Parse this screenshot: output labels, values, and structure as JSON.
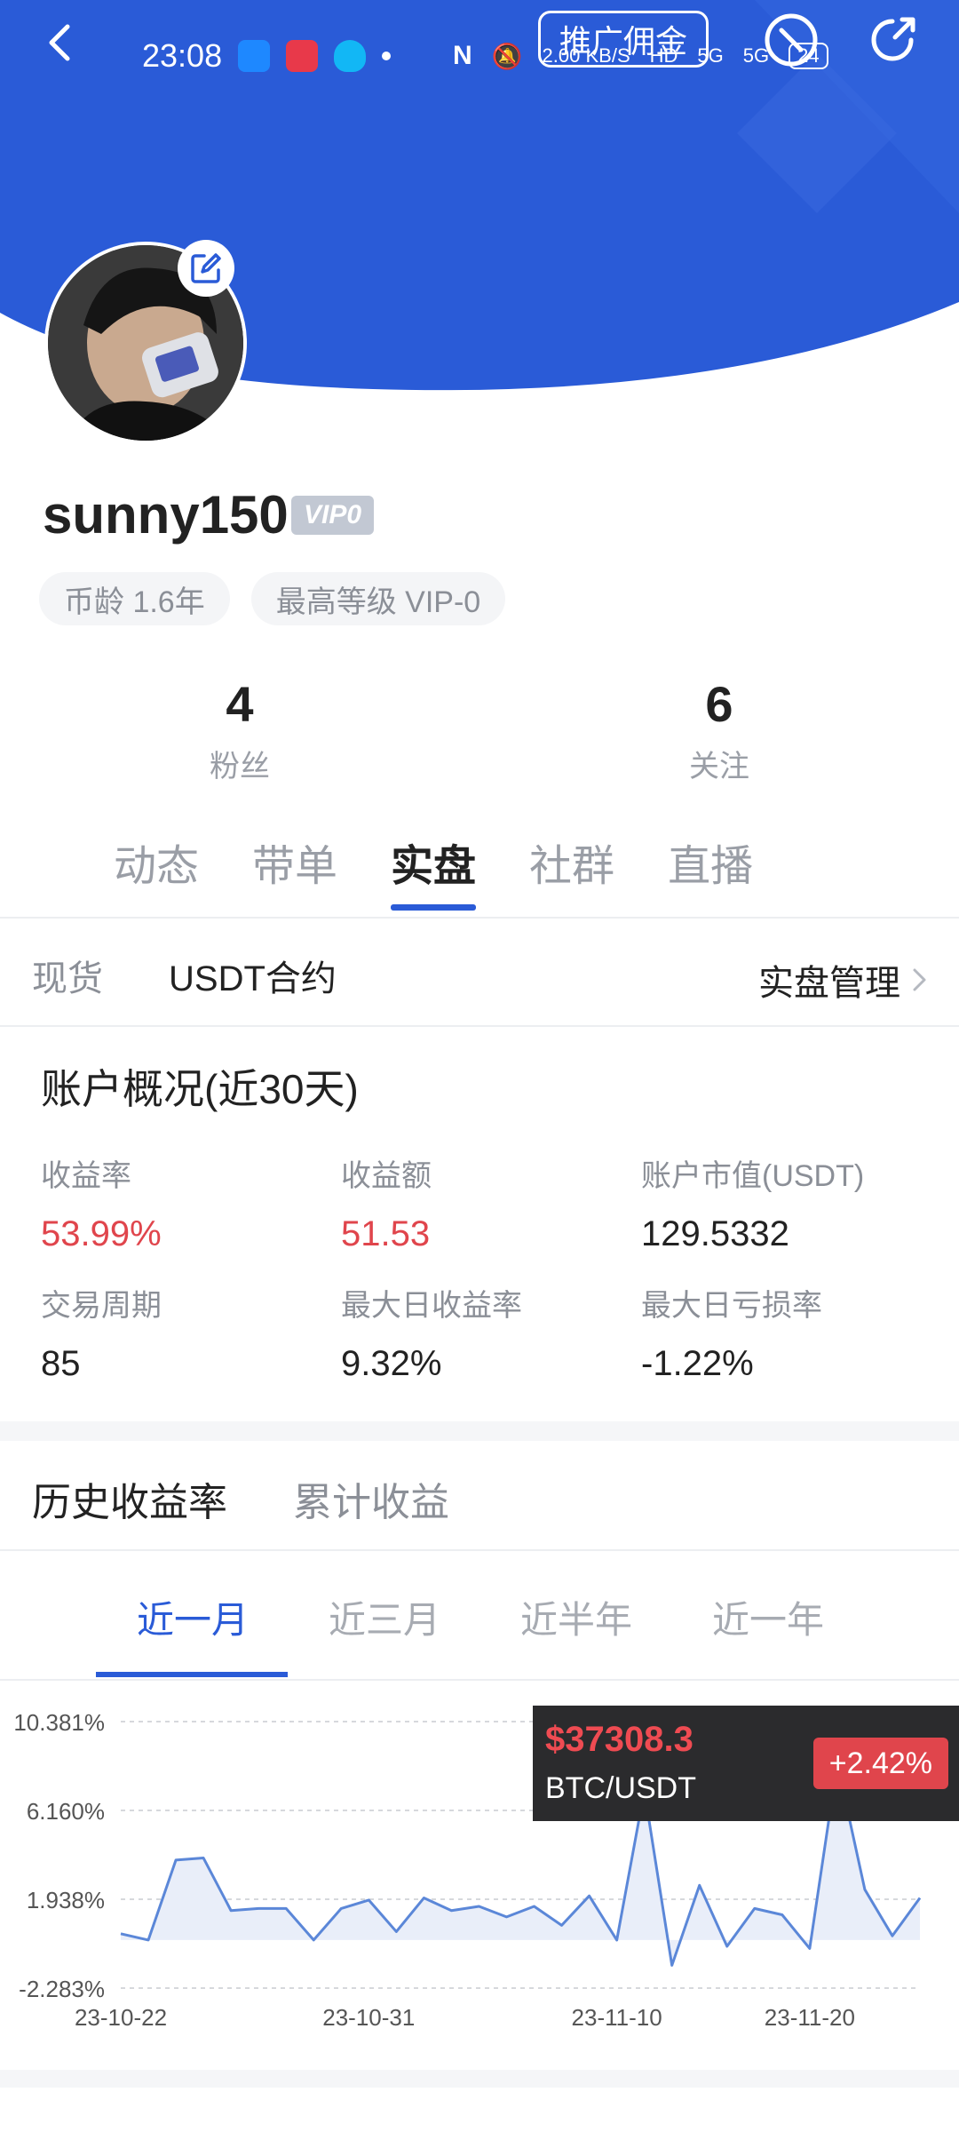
{
  "status_bar": {
    "time": "23:08",
    "network_speed": "2.00",
    "speed_unit": "KB/S",
    "hd": "HD",
    "net1": "5G",
    "net2": "5G",
    "battery": "24"
  },
  "header": {
    "promo_label": "推广佣金",
    "brand_color": "#2a5bd7"
  },
  "profile": {
    "username": "sunny150",
    "vip_badge": "VIP0",
    "coin_age": "币龄 1.6年",
    "max_level": "最高等级 VIP-0"
  },
  "stats": [
    {
      "value": "4",
      "label": "粉丝"
    },
    {
      "value": "6",
      "label": "关注"
    }
  ],
  "tabs": [
    {
      "label": "动态"
    },
    {
      "label": "带单"
    },
    {
      "label": "实盘",
      "active": true
    },
    {
      "label": "社群"
    },
    {
      "label": "直播"
    }
  ],
  "subtabs": {
    "spot": "现货",
    "usdt_contract": "USDT合约",
    "manage": "实盘管理"
  },
  "overview": {
    "title": "账户概况(近30天)",
    "metrics": [
      {
        "label": "收益率",
        "value": "53.99%",
        "color": "#e0454c"
      },
      {
        "label": "收益额",
        "value": "51.53",
        "color": "#e0454c"
      },
      {
        "label": "账户市值(USDT)",
        "value": "129.5332"
      },
      {
        "label": "交易周期",
        "value": "85"
      },
      {
        "label": "最大日收益率",
        "value": "9.32%"
      },
      {
        "label": "最大日亏损率",
        "value": "-1.22%"
      }
    ]
  },
  "history_tabs": {
    "rate": "历史收益率",
    "cumulative": "累计收益"
  },
  "periods": [
    {
      "label": "近一月",
      "active": true
    },
    {
      "label": "近三月"
    },
    {
      "label": "近半年"
    },
    {
      "label": "近一年"
    }
  ],
  "tooltip": {
    "price": "$37308.3",
    "pair": "BTC/USDT",
    "change": "+2.42%"
  },
  "chart_data": {
    "type": "line",
    "ytick_labels": [
      "10.381%",
      "6.160%",
      "1.938%",
      "-2.283%"
    ],
    "yticks": [
      10.381,
      6.16,
      1.938,
      -2.283
    ],
    "xtick_labels": [
      "23-10-22",
      "23-10-31",
      "23-11-10",
      "23-11-20"
    ],
    "xtick_index": [
      0,
      9,
      18,
      25
    ],
    "ylim": [
      -2.283,
      10.381
    ],
    "series": [
      {
        "values": [
          0.3,
          0.0,
          3.8,
          3.9,
          1.4,
          1.5,
          1.5,
          0.0,
          1.5,
          1.9,
          0.4,
          2.0,
          1.4,
          1.6,
          1.1,
          1.6,
          0.7,
          2.1,
          0.0,
          7.1,
          -1.2,
          2.6,
          -0.3,
          1.5,
          1.2,
          -0.4,
          8.4,
          2.4,
          0.2,
          2.0
        ]
      }
    ],
    "line_color": "#5b87d8",
    "fill_color": "#e9eef9",
    "grid": "dashed"
  }
}
